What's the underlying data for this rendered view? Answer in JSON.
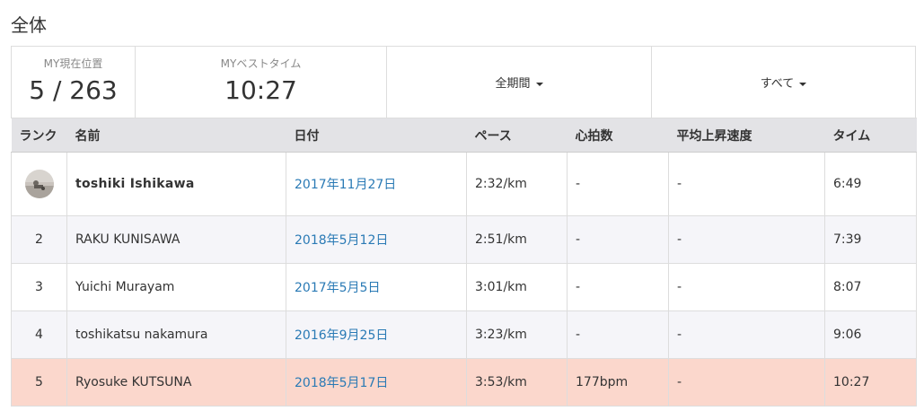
{
  "page": {
    "title": "全体"
  },
  "stats": {
    "position_label": "MY現在位置",
    "position_value": "5 / 263",
    "best_label": "MYベストタイム",
    "best_value": "10:27",
    "period_dropdown": "全期間",
    "filter_dropdown": "すべて"
  },
  "table": {
    "headers": [
      "ランク",
      "名前",
      "日付",
      "ペース",
      "心拍数",
      "平均上昇速度",
      "タイム"
    ],
    "rows": [
      {
        "rank": "",
        "avatar_icon": "avatar-photo-icon",
        "name": "toshiki Ishikawa",
        "date": "2017年11月27日",
        "pace": "2:32/km",
        "heart_rate": "-",
        "avg_climb": "-",
        "time": "6:49"
      },
      {
        "rank": "2",
        "name": "RAKU KUNISAWA",
        "date": "2018年5月12日",
        "pace": "2:51/km",
        "heart_rate": "-",
        "avg_climb": "-",
        "time": "7:39"
      },
      {
        "rank": "3",
        "name": "Yuichi Murayam",
        "date": "2017年5月5日",
        "pace": "3:01/km",
        "heart_rate": "-",
        "avg_climb": "-",
        "time": "8:07"
      },
      {
        "rank": "4",
        "name": "toshikatsu nakamura",
        "date": "2016年9月25日",
        "pace": "3:23/km",
        "heart_rate": "-",
        "avg_climb": "-",
        "time": "9:06"
      },
      {
        "rank": "5",
        "name": "Ryosuke KUTSUNA",
        "date": "2018年5月17日",
        "pace": "3:53/km",
        "heart_rate": "177bpm",
        "avg_climb": "-",
        "time": "10:27"
      }
    ]
  },
  "colors": {
    "header_bg": "#e3e3e6",
    "alt_row_bg": "#f5f5f9",
    "highlight_row_bg": "#fbd7cc",
    "link": "#2a7ab5"
  }
}
